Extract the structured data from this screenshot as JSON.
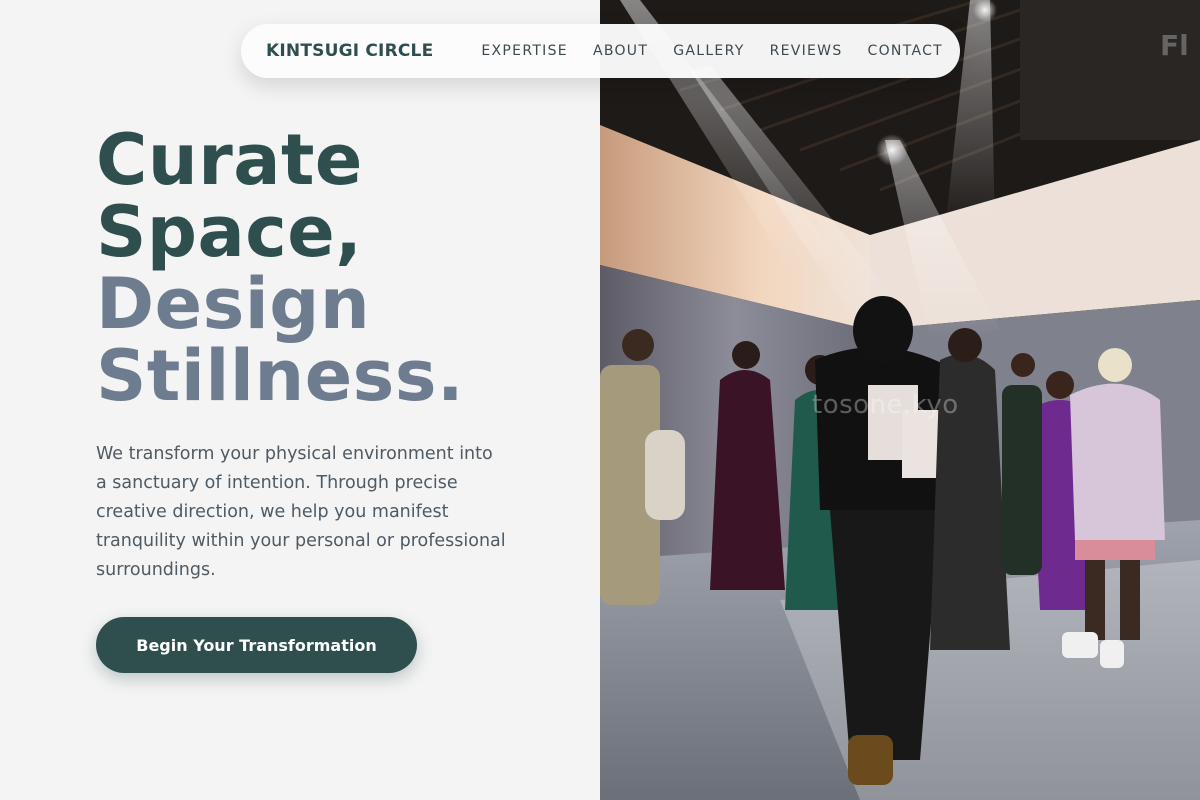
{
  "nav": {
    "brand": "KINTSUGI CIRCLE",
    "links": [
      "EXPERTISE",
      "ABOUT",
      "GALLERY",
      "REVIEWS",
      "CONTACT"
    ]
  },
  "hero": {
    "title_lines": [
      "Curate",
      "Space,",
      "Design",
      "Stillness."
    ],
    "description": "We transform your physical environment into a sanctuary of intention. Through precise creative direction, we help you manifest tranquility within your personal or professional surroundings.",
    "cta_label": "Begin Your Transformation"
  },
  "photo": {
    "watermark": "tosone.kyo"
  },
  "colors": {
    "primary": "#2f4f4f",
    "title_secondary": "#6e7c8f",
    "text": "#4f5a63",
    "background": "#f4f4f4"
  }
}
